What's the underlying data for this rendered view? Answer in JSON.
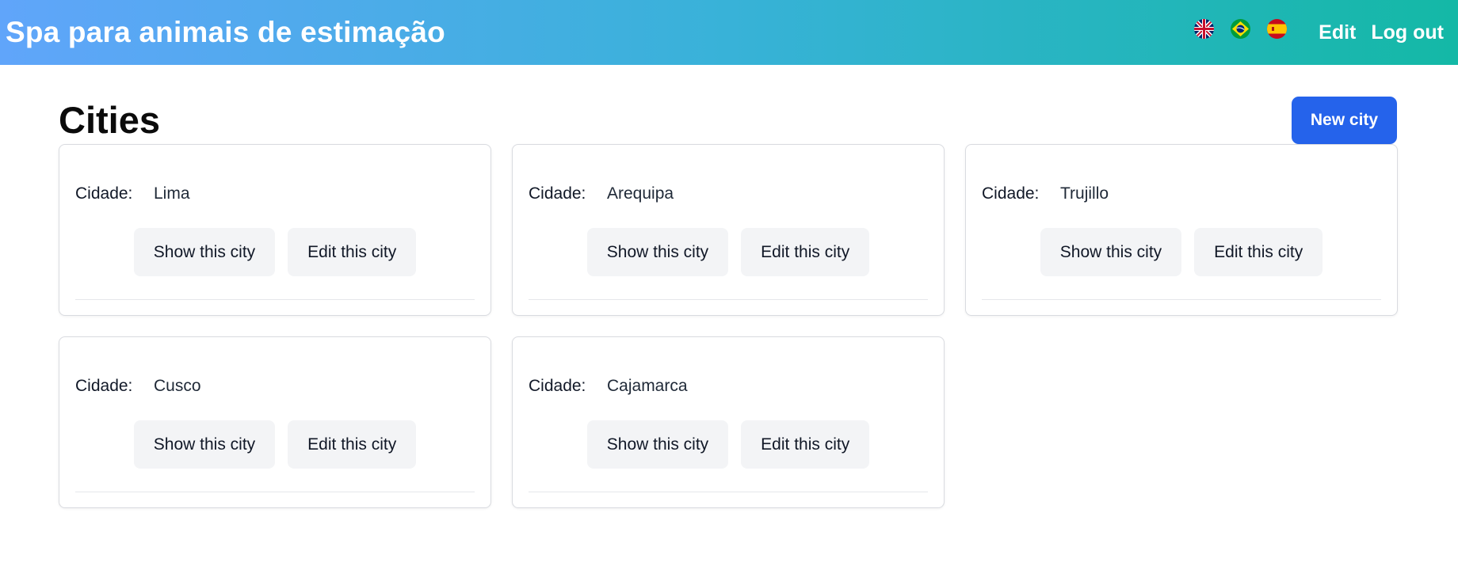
{
  "header": {
    "brand": "Spa para animais de estimação",
    "flags": [
      {
        "name": "uk-flag-icon"
      },
      {
        "name": "brazil-flag-icon"
      },
      {
        "name": "spain-flag-icon"
      }
    ],
    "edit_label": "Edit",
    "logout_label": "Log out",
    "gradient_start": "#60a5fa",
    "gradient_end": "#14b8a6"
  },
  "main": {
    "title": "Cities",
    "new_city_label": "New city",
    "accent": "#2563eb",
    "field_label": "Cidade:",
    "show_label": "Show this city",
    "edit_label": "Edit this city",
    "cities": [
      {
        "name": "Lima"
      },
      {
        "name": "Arequipa"
      },
      {
        "name": "Trujillo"
      },
      {
        "name": "Cusco"
      },
      {
        "name": "Cajamarca"
      }
    ]
  }
}
